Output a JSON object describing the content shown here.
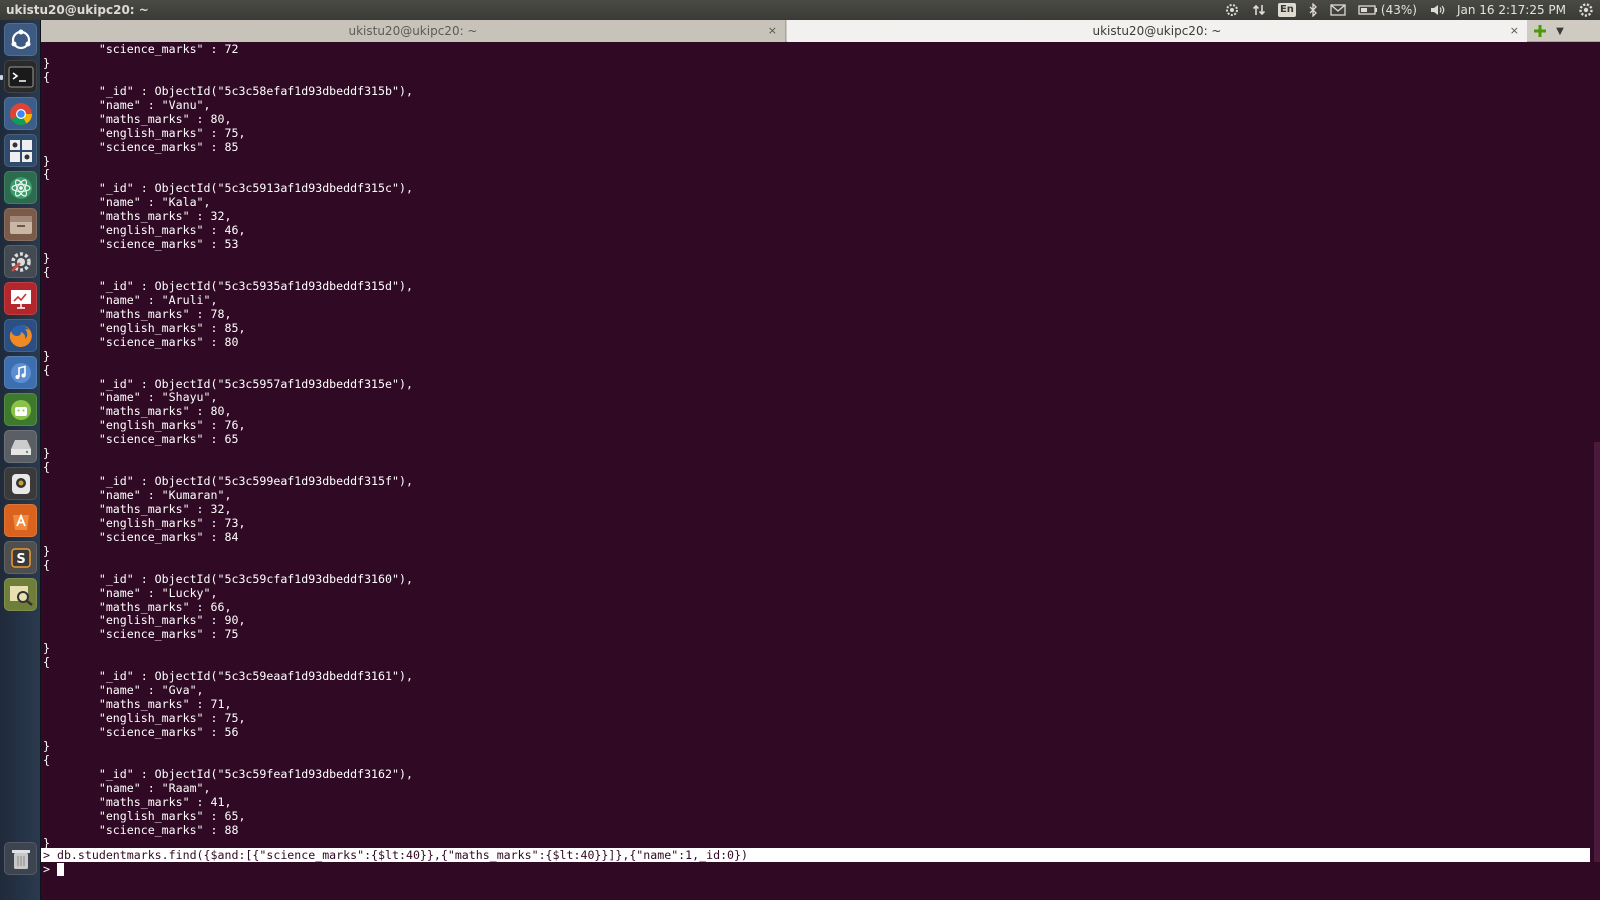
{
  "top_panel": {
    "window_title": "ukistu20@ukipc20: ~",
    "keyboard_layout": "En",
    "battery": "(43%)",
    "clock": "Jan 16  2:17:25 PM"
  },
  "tabs": [
    {
      "title": "ukistu20@ukipc20: ~",
      "close": "×",
      "active": false
    },
    {
      "title": "ukistu20@ukipc20: ~",
      "close": "×",
      "active": true
    }
  ],
  "launcher_icons": [
    "ubuntu-dash-icon",
    "terminal-icon",
    "chrome-icon",
    "system-tools-icon",
    "atom-icon",
    "files-icon",
    "settings-icon",
    "presentation-icon",
    "firefox-icon",
    "music-icon",
    "android-studio-icon",
    "drive-icon",
    "camera-icon",
    "software-center-icon",
    "sublime-text-icon",
    "image-viewer-icon",
    "trash-icon"
  ],
  "terminal": {
    "lines": [
      "        \"science_marks\" : 72",
      "}",
      "{",
      "        \"_id\" : ObjectId(\"5c3c58efaf1d93dbeddf315b\"),",
      "        \"name\" : \"Vanu\",",
      "        \"maths_marks\" : 80,",
      "        \"english_marks\" : 75,",
      "        \"science_marks\" : 85",
      "}",
      "{",
      "        \"_id\" : ObjectId(\"5c3c5913af1d93dbeddf315c\"),",
      "        \"name\" : \"Kala\",",
      "        \"maths_marks\" : 32,",
      "        \"english_marks\" : 46,",
      "        \"science_marks\" : 53",
      "}",
      "{",
      "        \"_id\" : ObjectId(\"5c3c5935af1d93dbeddf315d\"),",
      "        \"name\" : \"Aruli\",",
      "        \"maths_marks\" : 78,",
      "        \"english_marks\" : 85,",
      "        \"science_marks\" : 80",
      "}",
      "{",
      "        \"_id\" : ObjectId(\"5c3c5957af1d93dbeddf315e\"),",
      "        \"name\" : \"Shayu\",",
      "        \"maths_marks\" : 80,",
      "        \"english_marks\" : 76,",
      "        \"science_marks\" : 65",
      "}",
      "{",
      "        \"_id\" : ObjectId(\"5c3c599eaf1d93dbeddf315f\"),",
      "        \"name\" : \"Kumaran\",",
      "        \"maths_marks\" : 32,",
      "        \"english_marks\" : 73,",
      "        \"science_marks\" : 84",
      "}",
      "{",
      "        \"_id\" : ObjectId(\"5c3c59cfaf1d93dbeddf3160\"),",
      "        \"name\" : \"Lucky\",",
      "        \"maths_marks\" : 66,",
      "        \"english_marks\" : 90,",
      "        \"science_marks\" : 75",
      "}",
      "{",
      "        \"_id\" : ObjectId(\"5c3c59eaaf1d93dbeddf3161\"),",
      "        \"name\" : \"Gva\",",
      "        \"maths_marks\" : 71,",
      "        \"english_marks\" : 75,",
      "        \"science_marks\" : 56",
      "}",
      "{",
      "        \"_id\" : ObjectId(\"5c3c59feaf1d93dbeddf3162\"),",
      "        \"name\" : \"Raam\",",
      "        \"maths_marks\" : 41,",
      "        \"english_marks\" : 65,",
      "        \"science_marks\" : 88",
      "}"
    ],
    "command": "> db.studentmarks.find({$and:[{\"science_marks\":{$lt:40}},{\"maths_marks\":{$lt:40}}]},{\"name\":1,_id:0})",
    "prompt": ">"
  },
  "colors": {
    "terminal_bg": "#300a24",
    "terminal_fg": "#ffffff",
    "panel_bg": "#3c3b37"
  }
}
